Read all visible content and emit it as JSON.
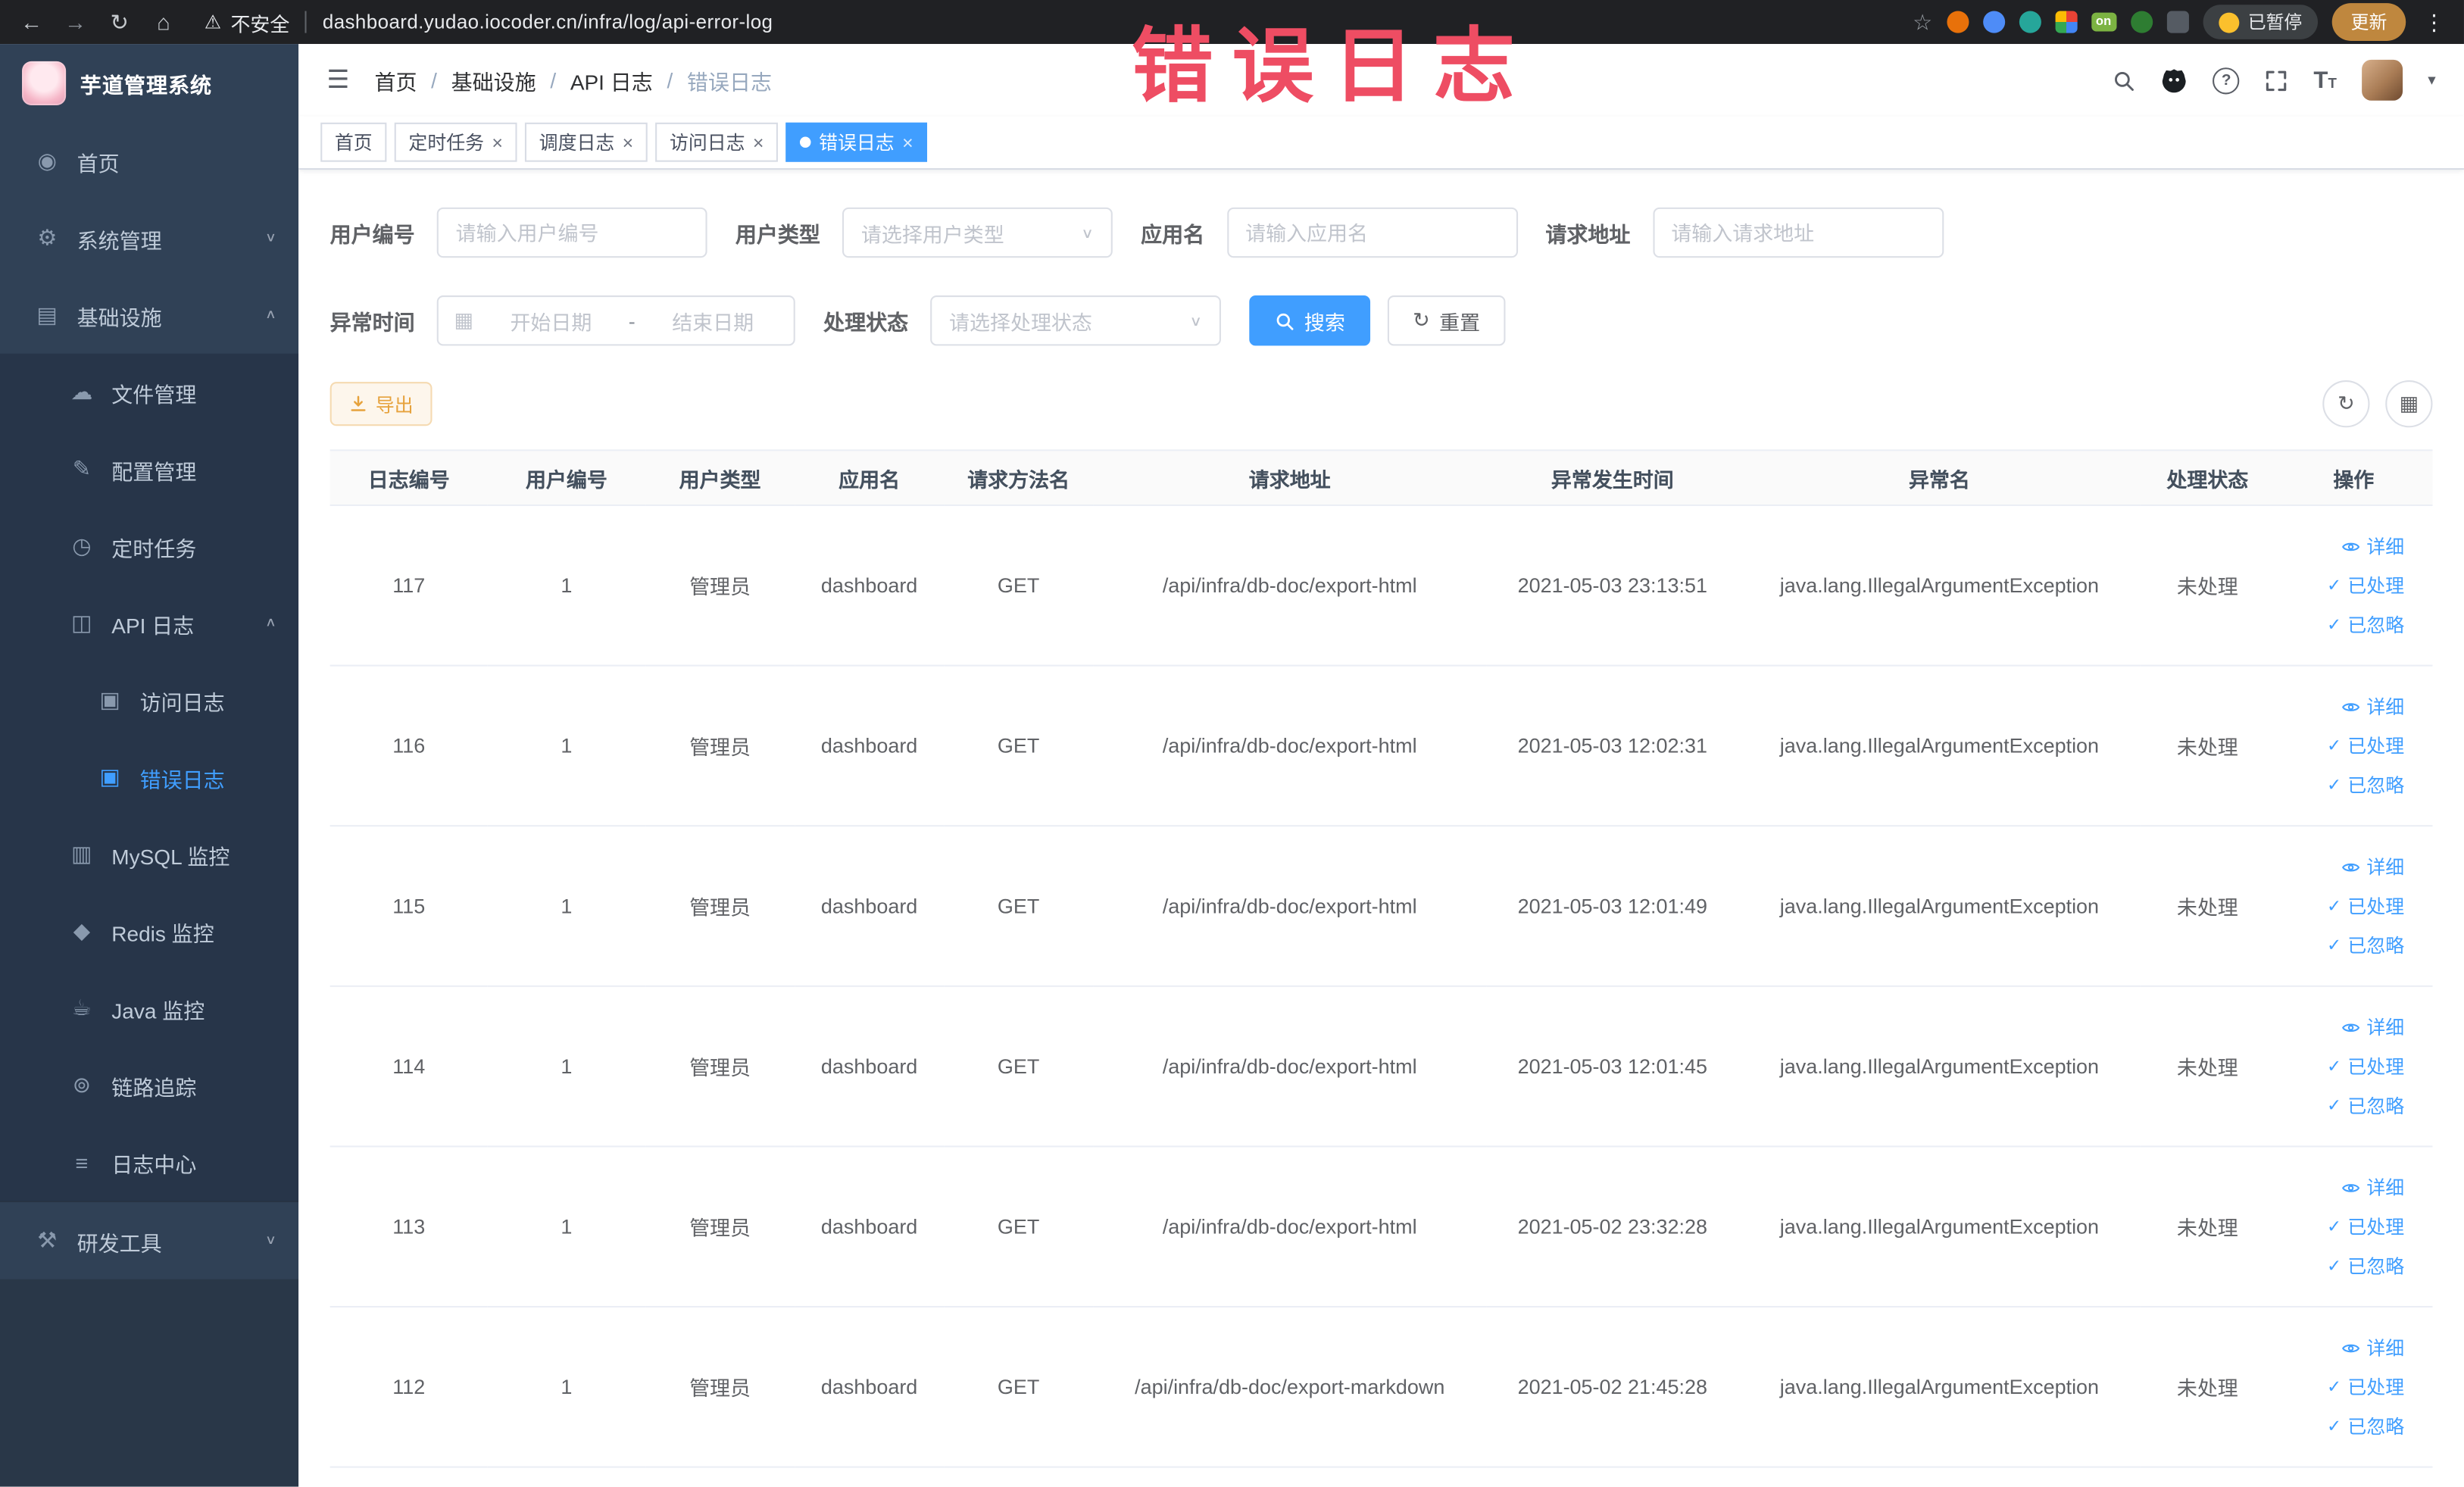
{
  "overlay": {
    "annotation": "错误日志"
  },
  "browser": {
    "security_label": "不安全",
    "url": "dashboard.yudao.iocoder.cn/infra/log/api-error-log",
    "on_label": "on",
    "paused_label": "已暂停",
    "update_label": "更新"
  },
  "sidebar": {
    "logo_title": "芋道管理系统",
    "items": [
      {
        "label": "首页"
      },
      {
        "label": "系统管理"
      },
      {
        "label": "基础设施"
      },
      {
        "label": "文件管理"
      },
      {
        "label": "配置管理"
      },
      {
        "label": "定时任务"
      },
      {
        "label": "API 日志"
      },
      {
        "label": "访问日志"
      },
      {
        "label": "错误日志"
      },
      {
        "label": "MySQL 监控"
      },
      {
        "label": "Redis 监控"
      },
      {
        "label": "Java 监控"
      },
      {
        "label": "链路追踪"
      },
      {
        "label": "日志中心"
      },
      {
        "label": "研发工具"
      }
    ]
  },
  "nav": {
    "breadcrumb": [
      "首页",
      "基础设施",
      "API 日志",
      "错误日志"
    ],
    "separator": "/"
  },
  "tabs": [
    {
      "label": "首页"
    },
    {
      "label": "定时任务"
    },
    {
      "label": "调度日志"
    },
    {
      "label": "访问日志"
    },
    {
      "label": "错误日志"
    }
  ],
  "filters": {
    "user_id": {
      "label": "用户编号",
      "placeholder": "请输入用户编号"
    },
    "user_type": {
      "label": "用户类型",
      "placeholder": "请选择用户类型"
    },
    "app_name": {
      "label": "应用名",
      "placeholder": "请输入应用名"
    },
    "request_url": {
      "label": "请求地址",
      "placeholder": "请输入请求地址"
    },
    "exception_time": {
      "label": "异常时间",
      "start_placeholder": "开始日期",
      "end_placeholder": "结束日期",
      "separator": "-"
    },
    "process_status": {
      "label": "处理状态",
      "placeholder": "请选择处理状态"
    },
    "search_label": "搜索",
    "reset_label": "重置"
  },
  "toolbar": {
    "export_label": "导出"
  },
  "table": {
    "columns": [
      "日志编号",
      "用户编号",
      "用户类型",
      "应用名",
      "请求方法名",
      "请求地址",
      "异常发生时间",
      "异常名",
      "处理状态",
      "操作"
    ],
    "actions": [
      "详细",
      "已处理",
      "已忽略"
    ],
    "rows": [
      {
        "id": "117",
        "user_id": "1",
        "user_type": "管理员",
        "app": "dashboard",
        "method": "GET",
        "url": "/api/infra/db-doc/export-html",
        "time": "2021-05-03 23:13:51",
        "exception": "java.lang.IllegalArgumentException",
        "status": "未处理"
      },
      {
        "id": "116",
        "user_id": "1",
        "user_type": "管理员",
        "app": "dashboard",
        "method": "GET",
        "url": "/api/infra/db-doc/export-html",
        "time": "2021-05-03 12:02:31",
        "exception": "java.lang.IllegalArgumentException",
        "status": "未处理"
      },
      {
        "id": "115",
        "user_id": "1",
        "user_type": "管理员",
        "app": "dashboard",
        "method": "GET",
        "url": "/api/infra/db-doc/export-html",
        "time": "2021-05-03 12:01:49",
        "exception": "java.lang.IllegalArgumentException",
        "status": "未处理"
      },
      {
        "id": "114",
        "user_id": "1",
        "user_type": "管理员",
        "app": "dashboard",
        "method": "GET",
        "url": "/api/infra/db-doc/export-html",
        "time": "2021-05-03 12:01:45",
        "exception": "java.lang.IllegalArgumentException",
        "status": "未处理"
      },
      {
        "id": "113",
        "user_id": "1",
        "user_type": "管理员",
        "app": "dashboard",
        "method": "GET",
        "url": "/api/infra/db-doc/export-html",
        "time": "2021-05-02 23:32:28",
        "exception": "java.lang.IllegalArgumentException",
        "status": "未处理"
      },
      {
        "id": "112",
        "user_id": "1",
        "user_type": "管理员",
        "app": "dashboard",
        "method": "GET",
        "url": "/api/infra/db-doc/export-markdown",
        "time": "2021-05-02 21:45:28",
        "exception": "java.lang.IllegalArgumentException",
        "status": "未处理"
      }
    ]
  },
  "icons": {
    "back": "←",
    "forward": "→",
    "reload": "↻",
    "home": "⌂",
    "warning": "⚠",
    "star": "☆",
    "kebab": "⋮",
    "hamburger": "☰",
    "caret_down": "▾",
    "question": "?",
    "font_large": "T",
    "font_small": "T",
    "dashboard": "◉",
    "gear": "⚙",
    "infra": "▤",
    "file": "☁",
    "config": "✎",
    "timer": "◷",
    "api_log": "◫",
    "log_doc": "▣",
    "mysql": "▥",
    "redis": "◆",
    "java": "☕",
    "trace": "⊚",
    "log_center": "≡",
    "tools": "⚒",
    "chevron_down": "∨",
    "chevron_up": "∧",
    "select_arrow": "∨",
    "calendar": "▦",
    "reset": "↻",
    "refresh": "↻",
    "columns": "▦",
    "check": "✓",
    "close": "×"
  },
  "colors": {
    "accent": "#409eff",
    "warning": "#e6a23c",
    "annotation": "#ee4d63",
    "sidebar_bg": "#304156",
    "chrome_bg": "#202124"
  }
}
